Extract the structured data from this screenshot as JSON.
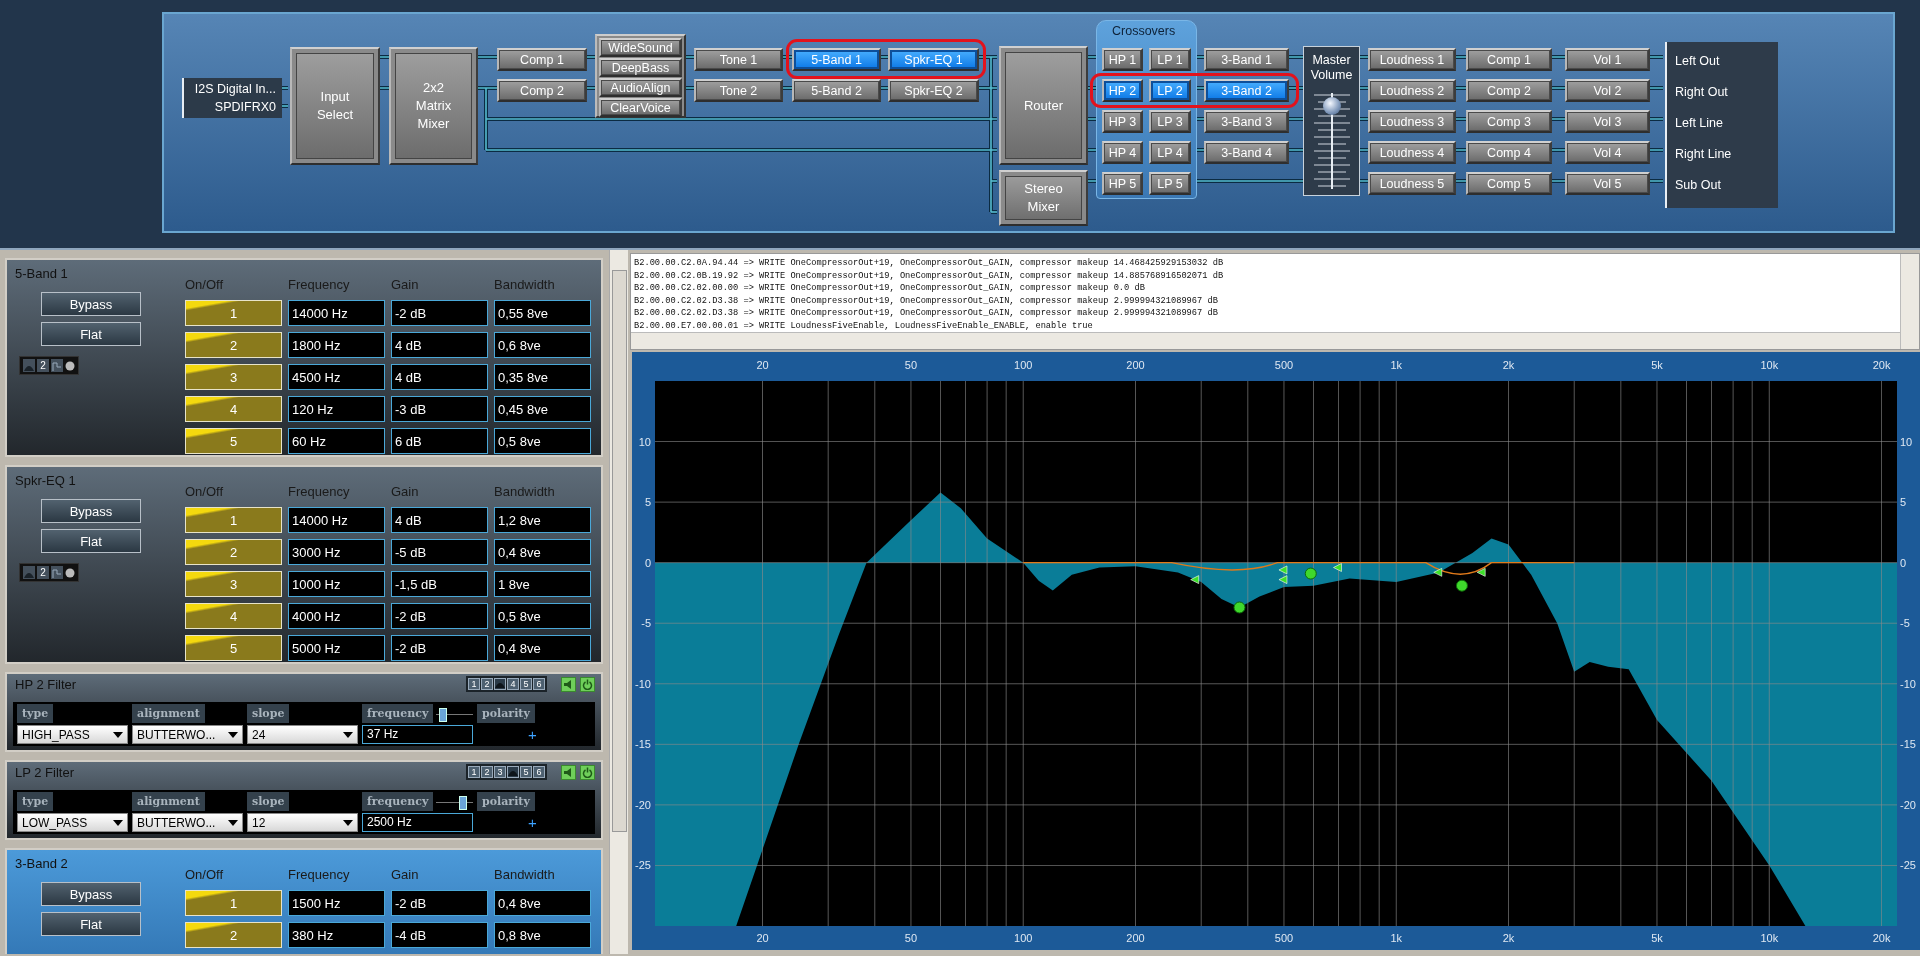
{
  "signal_flow": {
    "input": {
      "name": "I2S Digital In...",
      "device": "SPDIFRX0"
    },
    "input_select": {
      "label": "Input Select",
      "selected": false
    },
    "matrix_mixer": {
      "label": "2x2 Matrix Mixer",
      "selected": false
    },
    "compressors": [
      {
        "label": "Comp 1",
        "selected": false
      },
      {
        "label": "Comp 2",
        "selected": false
      }
    ],
    "effects": [
      {
        "label": "WideSound",
        "selected": false
      },
      {
        "label": "DeepBass",
        "selected": false
      },
      {
        "label": "AudioAlign",
        "selected": false
      },
      {
        "label": "ClearVoice",
        "selected": false
      }
    ],
    "tones": [
      {
        "label": "Tone 1",
        "selected": false
      },
      {
        "label": "Tone 2",
        "selected": false
      }
    ],
    "five_bands": [
      {
        "label": "5-Band 1",
        "selected": true
      },
      {
        "label": "5-Band 2",
        "selected": false
      }
    ],
    "speaker_eqs": [
      {
        "label": "Spkr-EQ 1",
        "selected": true
      },
      {
        "label": "Spkr-EQ 2",
        "selected": false
      }
    ],
    "router": {
      "label": "Router",
      "selected": false
    },
    "stereo_mixer": {
      "label": "Stereo Mixer",
      "selected": false
    },
    "crossovers": {
      "title": "Crossovers",
      "high_pass": [
        {
          "label": "HP 1",
          "selected": false
        },
        {
          "label": "HP 2",
          "selected": true
        },
        {
          "label": "HP 3",
          "selected": false
        },
        {
          "label": "HP 4",
          "selected": false
        },
        {
          "label": "HP 5",
          "selected": false
        }
      ],
      "low_pass": [
        {
          "label": "LP 1",
          "selected": false
        },
        {
          "label": "LP 2",
          "selected": true
        },
        {
          "label": "LP 3",
          "selected": false
        },
        {
          "label": "LP 4",
          "selected": false
        },
        {
          "label": "LP 5",
          "selected": false
        }
      ]
    },
    "three_bands": [
      {
        "label": "3-Band 1",
        "selected": false
      },
      {
        "label": "3-Band 2",
        "selected": true
      },
      {
        "label": "3-Band 3",
        "selected": false
      },
      {
        "label": "3-Band 4",
        "selected": false
      }
    ],
    "master_volume": {
      "label": "Master Volume",
      "level": 0.85
    },
    "loudness": [
      {
        "label": "Loudness 1",
        "selected": false
      },
      {
        "label": "Loudness 2",
        "selected": false
      },
      {
        "label": "Loudness 3",
        "selected": false
      },
      {
        "label": "Loudness 4",
        "selected": false
      },
      {
        "label": "Loudness 5",
        "selected": false
      }
    ],
    "output_compressors": [
      {
        "label": "Comp 1",
        "selected": false
      },
      {
        "label": "Comp 2",
        "selected": false
      },
      {
        "label": "Comp 3",
        "selected": false
      },
      {
        "label": "Comp 4",
        "selected": false
      },
      {
        "label": "Comp 5",
        "selected": false
      }
    ],
    "volumes": [
      {
        "label": "Vol 1",
        "selected": false
      },
      {
        "label": "Vol 2",
        "selected": false
      },
      {
        "label": "Vol 3",
        "selected": false
      },
      {
        "label": "Vol 4",
        "selected": false
      },
      {
        "label": "Vol 5",
        "selected": false
      }
    ],
    "outputs": [
      "Left Out",
      "Right Out",
      "Left Line",
      "Right Line",
      "Sub Out"
    ]
  },
  "panels": [
    {
      "kind": "eq",
      "title": "5-Band 1",
      "selected": false,
      "buttons": [
        "Bypass",
        "Flat"
      ],
      "preset": "2",
      "headers": [
        "On/Off",
        "Frequency",
        "Gain",
        "Bandwidth"
      ],
      "bands": [
        {
          "number": "1",
          "on": true,
          "frequency": "14000 Hz",
          "gain": "-2 dB",
          "bandwidth": "0,55 8ve"
        },
        {
          "number": "2",
          "on": true,
          "frequency": "1800 Hz",
          "gain": "4 dB",
          "bandwidth": "0,6 8ve"
        },
        {
          "number": "3",
          "on": true,
          "frequency": "4500 Hz",
          "gain": "4 dB",
          "bandwidth": "0,35 8ve"
        },
        {
          "number": "4",
          "on": true,
          "frequency": "120 Hz",
          "gain": "-3 dB",
          "bandwidth": "0,45 8ve"
        },
        {
          "number": "5",
          "on": true,
          "frequency": "60 Hz",
          "gain": "6 dB",
          "bandwidth": "0,5 8ve"
        }
      ]
    },
    {
      "kind": "eq",
      "title": "Spkr-EQ 1",
      "selected": false,
      "buttons": [
        "Bypass",
        "Flat"
      ],
      "preset": "2",
      "headers": [
        "On/Off",
        "Frequency",
        "Gain",
        "Bandwidth"
      ],
      "bands": [
        {
          "number": "1",
          "on": true,
          "frequency": "14000 Hz",
          "gain": "4 dB",
          "bandwidth": "1,2 8ve"
        },
        {
          "number": "2",
          "on": true,
          "frequency": "3000 Hz",
          "gain": "-5 dB",
          "bandwidth": "0,4 8ve"
        },
        {
          "number": "3",
          "on": true,
          "frequency": "1000 Hz",
          "gain": "-1,5 dB",
          "bandwidth": "1 8ve"
        },
        {
          "number": "4",
          "on": true,
          "frequency": "4000 Hz",
          "gain": "-2 dB",
          "bandwidth": "0,5 8ve"
        },
        {
          "number": "5",
          "on": true,
          "frequency": "5000 Hz",
          "gain": "-2 dB",
          "bandwidth": "0,4 8ve"
        }
      ]
    },
    {
      "kind": "filter",
      "title": "HP 2 Filter",
      "slots": [
        {
          "label": "1",
          "selected": false
        },
        {
          "label": "2",
          "selected": false
        },
        {
          "selected": true
        },
        {
          "label": "4",
          "selected": false
        },
        {
          "label": "5",
          "selected": false
        },
        {
          "label": "6",
          "selected": false
        }
      ],
      "fields": [
        {
          "kind": "dropdown",
          "label": "type",
          "value": "HIGH_PASS"
        },
        {
          "kind": "dropdown",
          "label": "alignment",
          "value": "BUTTERWO..."
        },
        {
          "kind": "dropdown",
          "label": "slope",
          "value": "24"
        },
        {
          "kind": "slider",
          "label": "frequency",
          "value": "37 Hz",
          "level": 0.16
        },
        {
          "kind": "toggle",
          "label": "polarity",
          "value": "+"
        }
      ]
    },
    {
      "kind": "filter",
      "title": "LP 2 Filter",
      "slots": [
        {
          "label": "1",
          "selected": false
        },
        {
          "label": "2",
          "selected": false
        },
        {
          "label": "3",
          "selected": false
        },
        {
          "selected": true
        },
        {
          "label": "5",
          "selected": false
        },
        {
          "label": "6",
          "selected": false
        }
      ],
      "fields": [
        {
          "kind": "dropdown",
          "label": "type",
          "value": "LOW_PASS"
        },
        {
          "kind": "dropdown",
          "label": "alignment",
          "value": "BUTTERWO..."
        },
        {
          "kind": "dropdown",
          "label": "slope",
          "value": "12"
        },
        {
          "kind": "slider",
          "label": "frequency",
          "value": "2500 Hz",
          "level": 0.7
        },
        {
          "kind": "toggle",
          "label": "polarity",
          "value": "+"
        }
      ]
    },
    {
      "kind": "eq",
      "title": "3-Band 2",
      "selected": true,
      "buttons": [
        "Bypass",
        "Flat"
      ],
      "headers": [
        "On/Off",
        "Frequency",
        "Gain",
        "Bandwidth"
      ],
      "bands": [
        {
          "number": "1",
          "on": true,
          "frequency": "1500 Hz",
          "gain": "-2 dB",
          "bandwidth": "0,4 8ve"
        },
        {
          "number": "2",
          "on": true,
          "frequency": "380 Hz",
          "gain": "-4 dB",
          "bandwidth": "0,8 8ve"
        }
      ]
    }
  ],
  "log": {
    "lines": [
      "B2.00.00.C2.0A.94.44 => WRITE OneCompressorOut+19, OneCompressorOut_GAIN, compressor makeup 14.468425929153032 dB",
      "B2.00.00.C2.0B.19.92 => WRITE OneCompressorOut+19, OneCompressorOut_GAIN, compressor makeup 14.885768916502071 dB",
      "B2.00.00.C2.02.00.00 => WRITE OneCompressorOut+19, OneCompressorOut_GAIN, compressor makeup 0.0 dB",
      "B2.00.00.C2.02.D3.38 => WRITE OneCompressorOut+19, OneCompressorOut_GAIN, compressor makeup 2.999994321089967 dB",
      "B2.00.00.C2.02.D3.38 => WRITE OneCompressorOut+19, OneCompressorOut_GAIN, compressor makeup 2.999994321089967 dB",
      "B2.00.00.E7.00.00.01 => WRITE LoudnessFiveEnable, LoudnessFiveEnable_ENABLE, enable true"
    ]
  },
  "graph": {
    "top_labels": [
      "20",
      "50",
      "100",
      "200",
      "500",
      "1k",
      "2k",
      "5k",
      "10k",
      "20k"
    ],
    "bottom_labels": [
      "20",
      "50",
      "100",
      "200",
      "500",
      "1k",
      "2k",
      "5k",
      "10k",
      "20k"
    ],
    "left_labels": [
      "10",
      "5",
      "0",
      "-5",
      "-10",
      "-15",
      "-20",
      "-25"
    ],
    "right_labels": [
      "10",
      "5",
      "0",
      "-5",
      "-10",
      "-15",
      "-20",
      "-25"
    ]
  }
}
